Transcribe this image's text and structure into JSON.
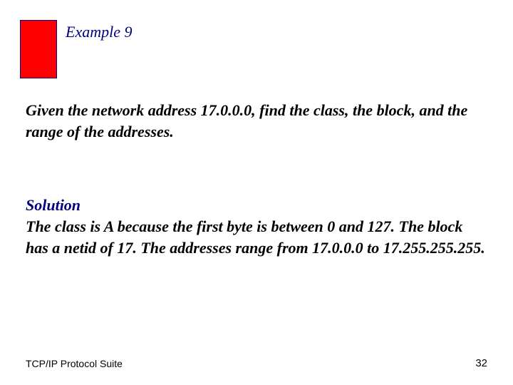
{
  "header": {
    "example_label": "Example 9"
  },
  "problem": {
    "text": "Given the network address 17.0.0.0, find the class, the block, and the range of the addresses."
  },
  "solution": {
    "label": "Solution",
    "body": "The class is A because the first byte is between 0 and 127. The block has a netid of 17. The addresses range from 17.0.0.0 to 17.255.255.255."
  },
  "footer": {
    "left": "TCP/IP Protocol Suite",
    "page_number": "32"
  }
}
